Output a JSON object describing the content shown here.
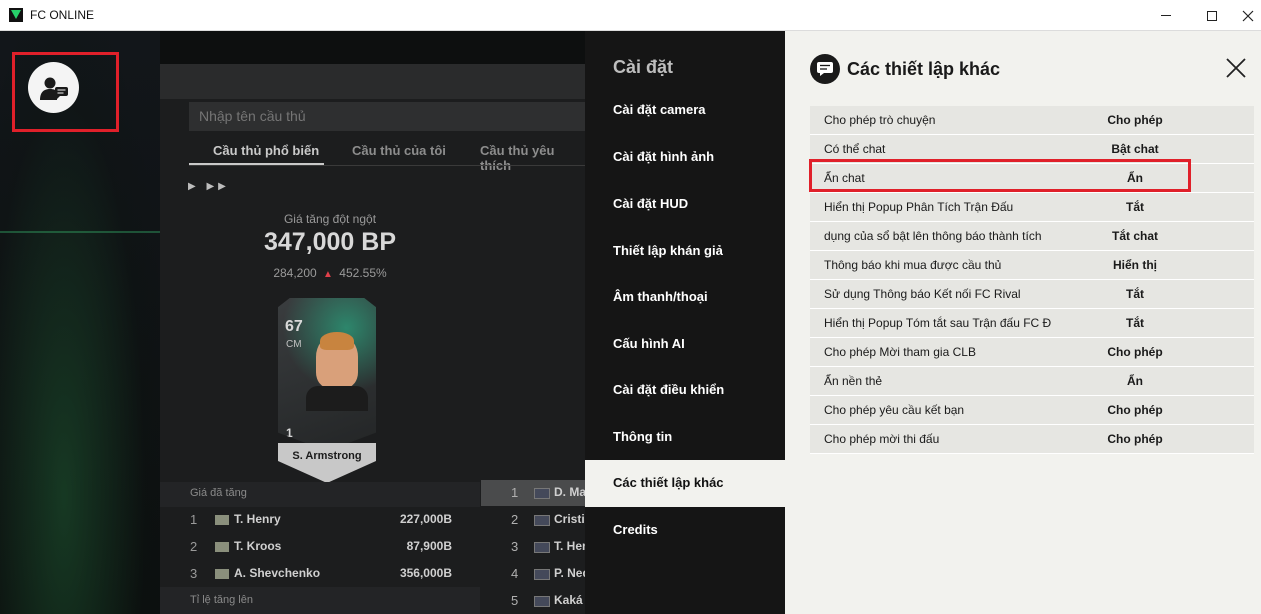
{
  "window": {
    "title": "FC ONLINE"
  },
  "game": {
    "search_placeholder": "Nhập tên cầu thủ",
    "tabs": [
      "Cầu thủ phổ biến",
      "Cầu thủ của tôi",
      "Cầu thủ yêu thích"
    ],
    "trend_label": "Giá tăng đột ngột",
    "trend_price": "347,000 BP",
    "trend_old": "284,200",
    "trend_pct": "452.55%",
    "card": {
      "ovr": "67",
      "pos": "CM",
      "num": "1",
      "name": "S. Armstrong"
    },
    "list_header": "Giá đã tăng",
    "list_rows": [
      {
        "rank": "1",
        "name": "T. Henry",
        "value": "227,000B"
      },
      {
        "rank": "2",
        "name": "T. Kroos",
        "value": "87,900B"
      },
      {
        "rank": "3",
        "name": "A. Shevchenko",
        "value": "356,000B"
      }
    ],
    "list_footer": "Tỉ lệ tăng lên",
    "right_rows": [
      {
        "rank": "1",
        "name": "D. Mar"
      },
      {
        "rank": "2",
        "name": "Cristia"
      },
      {
        "rank": "3",
        "name": "T. Hen"
      },
      {
        "rank": "4",
        "name": "P. Ned"
      },
      {
        "rank": "5",
        "name": "Kaká"
      }
    ]
  },
  "nav": {
    "title": "Cài đặt",
    "items": [
      {
        "label": "Cài đặt camera"
      },
      {
        "label": "Cài đặt hình ảnh"
      },
      {
        "label": "Cài đặt HUD"
      },
      {
        "label": "Thiết lập khán giả"
      },
      {
        "label": "Âm thanh/thoại"
      },
      {
        "label": "Cấu hình AI"
      },
      {
        "label": "Cài đặt điều khiển"
      },
      {
        "label": "Thông tin"
      },
      {
        "label": "Các thiết lập khác",
        "active": true
      },
      {
        "label": "Credits"
      }
    ]
  },
  "content": {
    "title": "Các thiết lập khác",
    "rows": [
      {
        "label": "Cho phép trò chuyện",
        "value": "Cho phép"
      },
      {
        "label": "Có thể chat",
        "value": "Bật chat"
      },
      {
        "label": "Ẩn chat",
        "value": "Ẩn"
      },
      {
        "label": "Hiển thị Popup Phân Tích Trận Đấu",
        "value": "Tắt"
      },
      {
        "label": "dụng của sổ bật lên thông báo thành tích",
        "value": "Tắt chat"
      },
      {
        "label": "Thông báo khi mua được cầu thủ",
        "value": "Hiển thị"
      },
      {
        "label": "Sử dụng Thông báo Kết nối FC Rival",
        "value": "Tắt"
      },
      {
        "label": "Hiển thị Popup Tóm tắt sau Trận đấu FC Đ",
        "value": "Tắt"
      },
      {
        "label": "Cho phép Mời tham gia CLB",
        "value": "Cho phép"
      },
      {
        "label": "Ẩn nền thẻ",
        "value": "Ẩn"
      },
      {
        "label": "Cho phép yêu cầu kết bạn",
        "value": "Cho phép"
      },
      {
        "label": "Cho phép mời thi đấu",
        "value": "Cho phép"
      }
    ]
  },
  "colors": {
    "highlight": "#e0202a",
    "nav_bg": "#151515",
    "content_bg": "#f2f2ee"
  }
}
